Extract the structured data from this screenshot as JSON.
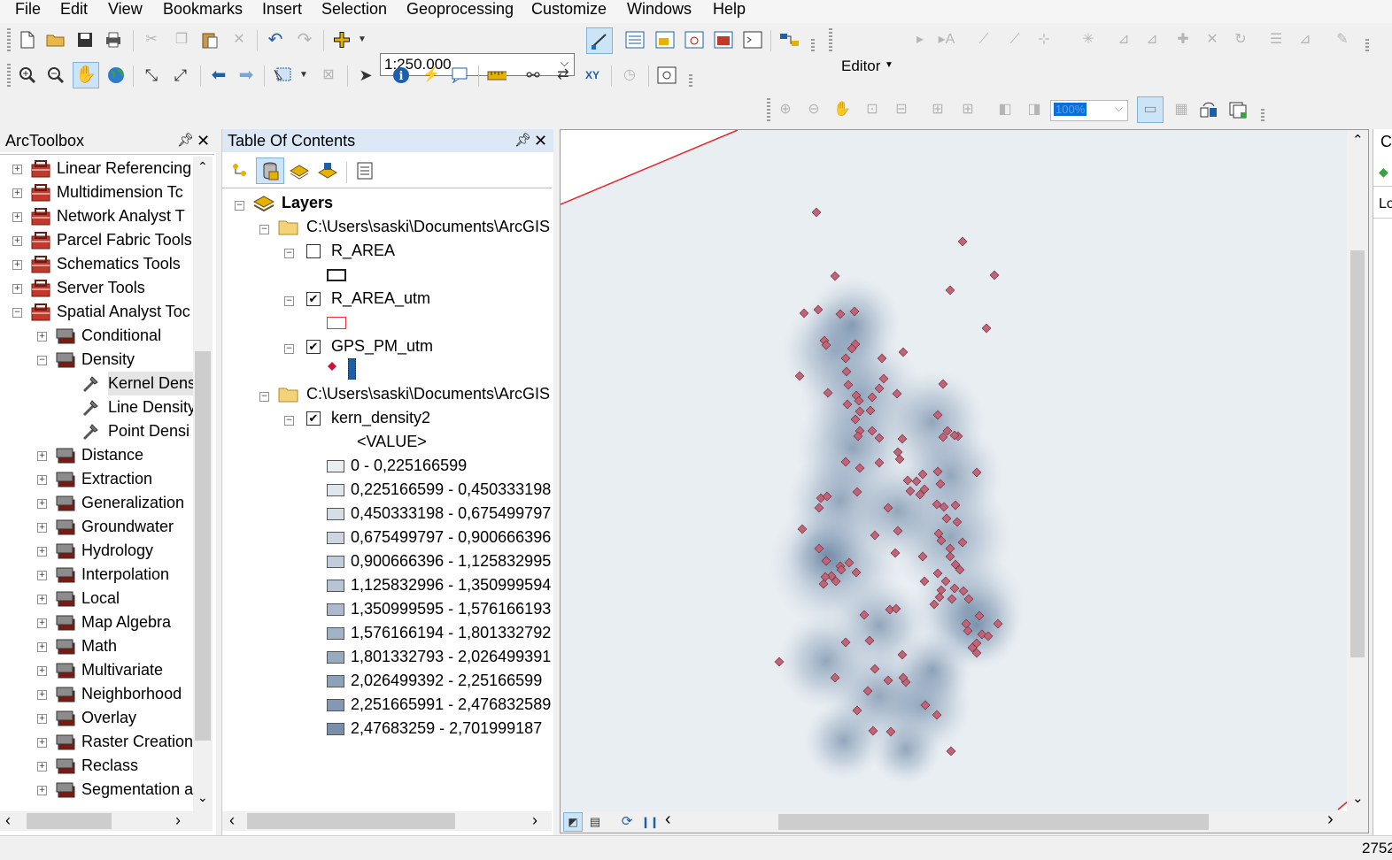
{
  "menu": [
    "File",
    "Edit",
    "View",
    "Bookmarks",
    "Insert",
    "Selection",
    "Geoprocessing",
    "Customize",
    "Windows",
    "Help"
  ],
  "toolbar": {
    "scale_value": "1:250.000",
    "editor_label": "Editor",
    "layout_zoom_value": "100%"
  },
  "arctoolbox": {
    "title": "ArcToolbox",
    "items": [
      {
        "label": "Linear Referencing",
        "level": 0,
        "expanded": false,
        "kind": "toolbox"
      },
      {
        "label": "Multidimension Tc",
        "level": 0,
        "expanded": false,
        "kind": "toolbox"
      },
      {
        "label": "Network Analyst T",
        "level": 0,
        "expanded": false,
        "kind": "toolbox"
      },
      {
        "label": "Parcel Fabric Tools",
        "level": 0,
        "expanded": false,
        "kind": "toolbox"
      },
      {
        "label": "Schematics Tools",
        "level": 0,
        "expanded": false,
        "kind": "toolbox"
      },
      {
        "label": "Server Tools",
        "level": 0,
        "expanded": false,
        "kind": "toolbox"
      },
      {
        "label": "Spatial Analyst Toc",
        "level": 0,
        "expanded": true,
        "kind": "toolbox"
      },
      {
        "label": "Conditional",
        "level": 1,
        "expanded": false,
        "kind": "toolset"
      },
      {
        "label": "Density",
        "level": 1,
        "expanded": true,
        "kind": "toolset"
      },
      {
        "label": "Kernel Dens",
        "level": 2,
        "kind": "tool",
        "selected": true
      },
      {
        "label": "Line Density",
        "level": 2,
        "kind": "tool"
      },
      {
        "label": "Point Densi",
        "level": 2,
        "kind": "tool"
      },
      {
        "label": "Distance",
        "level": 1,
        "expanded": false,
        "kind": "toolset"
      },
      {
        "label": "Extraction",
        "level": 1,
        "expanded": false,
        "kind": "toolset"
      },
      {
        "label": "Generalization",
        "level": 1,
        "expanded": false,
        "kind": "toolset"
      },
      {
        "label": "Groundwater",
        "level": 1,
        "expanded": false,
        "kind": "toolset"
      },
      {
        "label": "Hydrology",
        "level": 1,
        "expanded": false,
        "kind": "toolset"
      },
      {
        "label": "Interpolation",
        "level": 1,
        "expanded": false,
        "kind": "toolset"
      },
      {
        "label": "Local",
        "level": 1,
        "expanded": false,
        "kind": "toolset"
      },
      {
        "label": "Map Algebra",
        "level": 1,
        "expanded": false,
        "kind": "toolset"
      },
      {
        "label": "Math",
        "level": 1,
        "expanded": false,
        "kind": "toolset"
      },
      {
        "label": "Multivariate",
        "level": 1,
        "expanded": false,
        "kind": "toolset"
      },
      {
        "label": "Neighborhood",
        "level": 1,
        "expanded": false,
        "kind": "toolset"
      },
      {
        "label": "Overlay",
        "level": 1,
        "expanded": false,
        "kind": "toolset"
      },
      {
        "label": "Raster Creation",
        "level": 1,
        "expanded": false,
        "kind": "toolset"
      },
      {
        "label": "Reclass",
        "level": 1,
        "expanded": false,
        "kind": "toolset"
      },
      {
        "label": "Segmentation a",
        "level": 1,
        "expanded": false,
        "kind": "toolset"
      }
    ]
  },
  "toc": {
    "title": "Table Of Contents",
    "root": "Layers",
    "group1_path": "C:\\Users\\saski\\Documents\\ArcGIS\\",
    "group2_path": "C:\\Users\\saski\\Documents\\ArcGIS\\",
    "layers": {
      "r_area": "R_AREA",
      "r_area_utm": "R_AREA_utm",
      "gps": "GPS_PM_utm",
      "kern": "kern_density2",
      "value_header": "<VALUE>"
    },
    "classes": [
      {
        "label": "0 - 0,225166599",
        "color": "#e9eef3"
      },
      {
        "label": "0,225166599 - 0,450333198",
        "color": "#dfe6ed"
      },
      {
        "label": "0,450333198 - 0,675499797",
        "color": "#d5dee7"
      },
      {
        "label": "0,675499797 - 0,900666396",
        "color": "#cbd6e1"
      },
      {
        "label": "0,900666396 - 1,125832995",
        "color": "#c0cddb"
      },
      {
        "label": "1,125832996 - 1,350999594",
        "color": "#b6c4d4"
      },
      {
        "label": "1,350999595 - 1,576166193",
        "color": "#abbbcd"
      },
      {
        "label": "1,576166194 - 1,801332792",
        "color": "#a1b3c7"
      },
      {
        "label": "1,801332793 - 2,026499391",
        "color": "#97aac0"
      },
      {
        "label": "2,026499392 - 2,25166599",
        "color": "#8da1b9"
      },
      {
        "label": "2,251665991 - 2,476832589",
        "color": "#8398b2"
      },
      {
        "label": "2,47683259 - 2,701999187",
        "color": "#7a8fab"
      }
    ]
  },
  "right_panel": {
    "title_fragment": "C",
    "label_fragment": "Lo"
  },
  "status": {
    "coordinate_fragment": "2752"
  }
}
